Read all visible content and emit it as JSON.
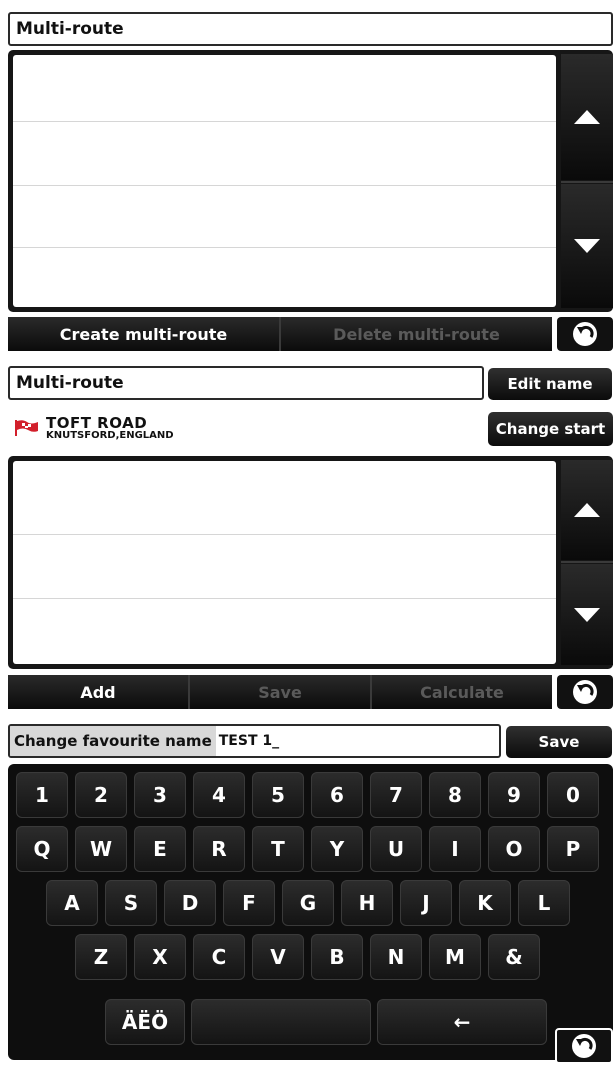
{
  "screen1": {
    "title": "Multi-route",
    "buttons": {
      "create": "Create multi-route",
      "delete": "Delete multi-route"
    }
  },
  "screen2": {
    "name_value": "Multi-route",
    "edit_name": "Edit name",
    "change_start": "Change start",
    "start": {
      "road": "TOFT ROAD",
      "place": "KNUTSFORD,ENGLAND"
    },
    "buttons": {
      "add": "Add",
      "save": "Save",
      "calculate": "Calculate"
    }
  },
  "screen3": {
    "label": "Change favourite name",
    "value": "TEST 1_",
    "save": "Save",
    "keys": {
      "row1": [
        "1",
        "2",
        "3",
        "4",
        "5",
        "6",
        "7",
        "8",
        "9",
        "0"
      ],
      "row2": [
        "Q",
        "W",
        "E",
        "R",
        "T",
        "Y",
        "U",
        "I",
        "O",
        "P"
      ],
      "row3": [
        "A",
        "S",
        "D",
        "F",
        "G",
        "H",
        "J",
        "K",
        "L"
      ],
      "row4": [
        "Z",
        "X",
        "C",
        "V",
        "B",
        "N",
        "M",
        "&"
      ],
      "special": "ÄËÖ",
      "backspace": "←"
    }
  },
  "icons": {
    "scroll_up": "up-arrow-icon",
    "scroll_down": "down-arrow-icon",
    "back": "back-icon",
    "flag": "flag-icon"
  },
  "colors": {
    "button_bg": "#111111",
    "flag_red": "#d21f2b",
    "disabled_text": "#5a5a5a"
  }
}
